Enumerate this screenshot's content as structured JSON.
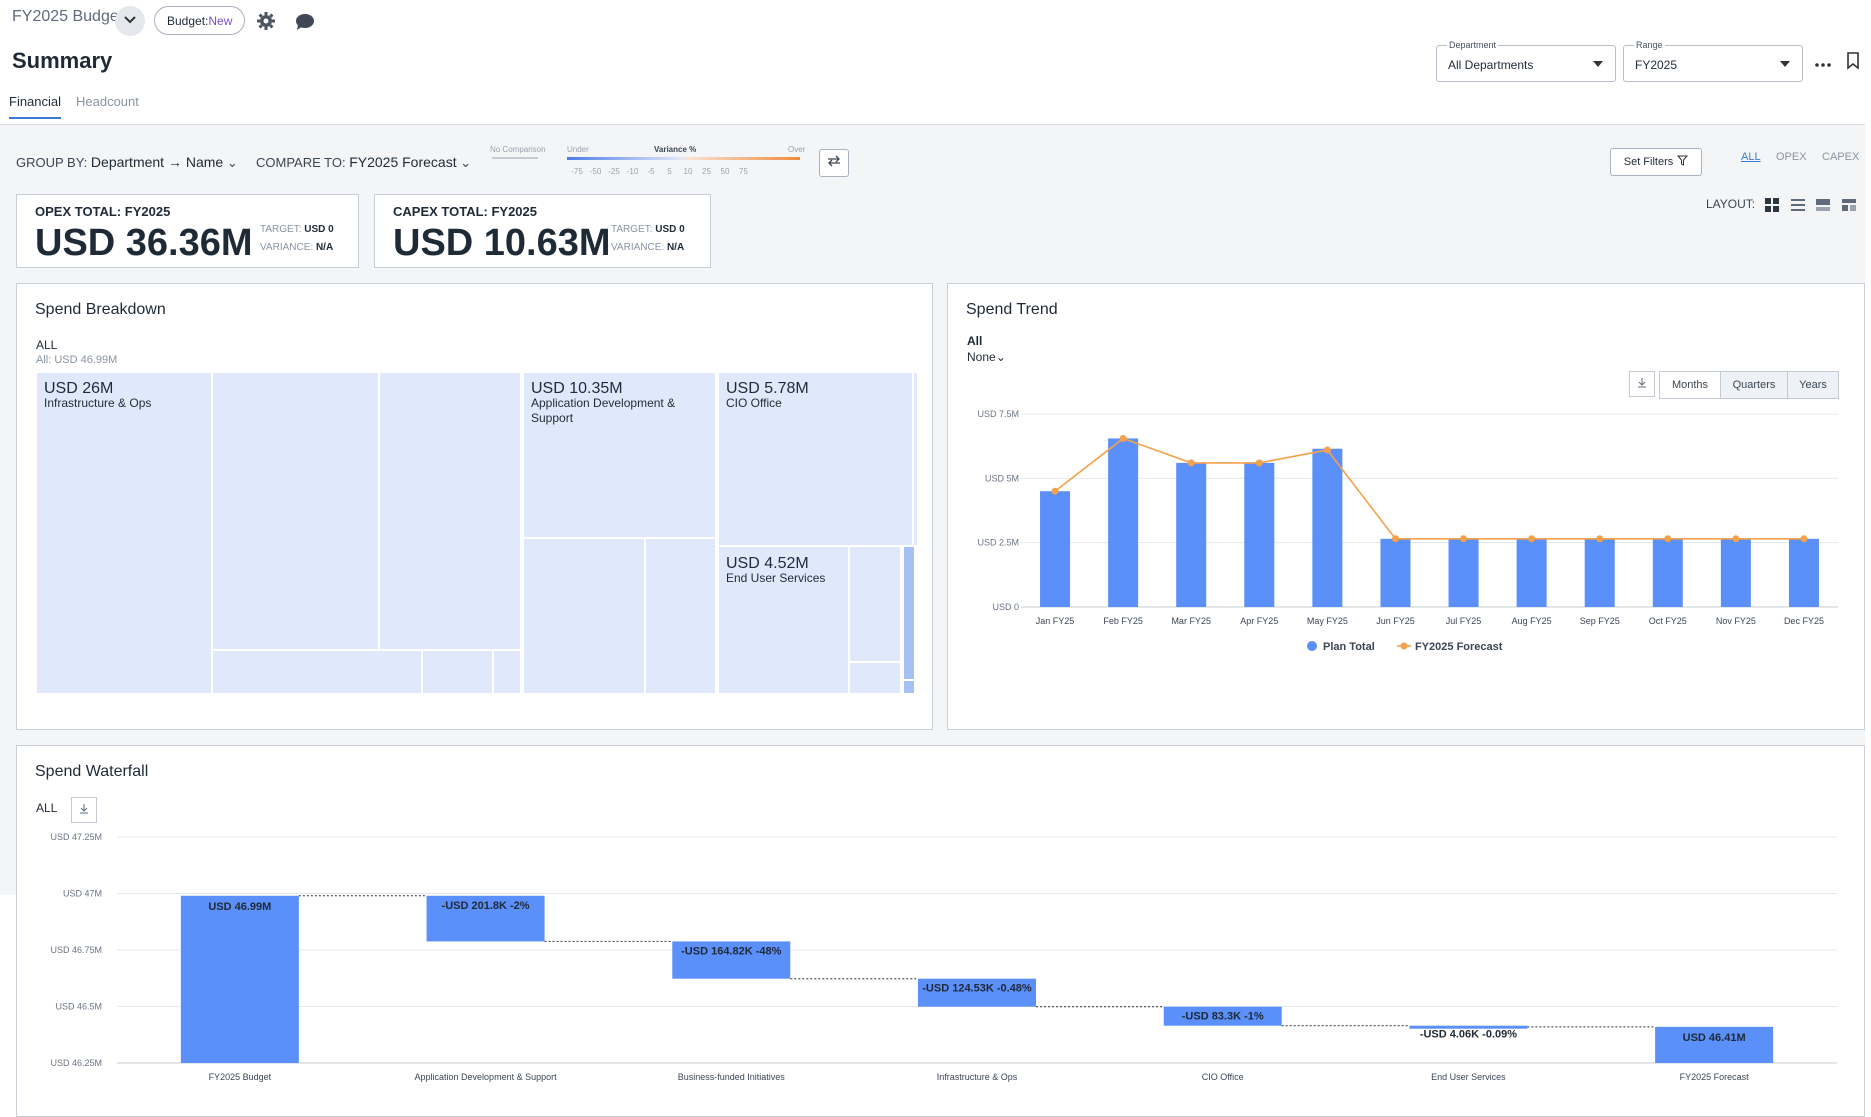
{
  "header": {
    "budget_name": "FY2025 Budget",
    "budget_badge_prefix": "Budget:",
    "budget_badge_status": "New",
    "page_title": "Summary",
    "tabs": [
      {
        "label": "Financial"
      },
      {
        "label": "Headcount"
      }
    ],
    "department": {
      "label": "Department",
      "value": "All Departments"
    },
    "range": {
      "label": "Range",
      "value": "FY2025"
    }
  },
  "filters": {
    "group_by_label": "GROUP BY:",
    "group_by_value": "Department → Name",
    "compare_label": "COMPARE TO:",
    "compare_value": "FY2025 Forecast",
    "variance_legend": {
      "no_comparison": "No Comparison",
      "under": "Under",
      "title": "Variance %",
      "over": "Over",
      "ticks": [
        "-75",
        "-50",
        "-25",
        "-10",
        "-5",
        "5",
        "10",
        "25",
        "50",
        "75"
      ]
    },
    "set_filters": "Set Filters",
    "scope": [
      "ALL",
      "OPEX",
      "CAPEX"
    ],
    "layout_label": "LAYOUT:"
  },
  "kpis": [
    {
      "title": "OPEX TOTAL: FY2025",
      "value": "USD 36.36M",
      "target_label": "TARGET:",
      "target": "USD 0",
      "variance_label": "VARIANCE:",
      "variance": "N/A"
    },
    {
      "title": "CAPEX TOTAL: FY2025",
      "value": "USD 10.63M",
      "target_label": "TARGET:",
      "target": "USD 0",
      "variance_label": "VARIANCE:",
      "variance": "N/A"
    }
  ],
  "spend_breakdown": {
    "title": "Spend Breakdown",
    "crumb": "ALL",
    "total": "All: USD 46.99M",
    "tiles": [
      {
        "value": "USD 26M",
        "name": "Infrastructure & Ops"
      },
      {
        "value": "USD 10.35M",
        "name": "Application Development & Support"
      },
      {
        "value": "USD 5.78M",
        "name": "CIO Office"
      },
      {
        "value": "USD 4.52M",
        "name": "End User Services"
      }
    ]
  },
  "spend_trend": {
    "title": "Spend Trend",
    "filter_value": "All",
    "compare_value": "None",
    "periods": [
      "Months",
      "Quarters",
      "Years"
    ],
    "colors": {
      "plan": "#5b8ff9",
      "forecast": "#f5a04a"
    }
  },
  "spend_waterfall": {
    "title": "Spend Waterfall",
    "crumb": "ALL"
  },
  "chart_data": [
    {
      "type": "bar",
      "title": "Spend Trend",
      "categories": [
        "Jan FY25",
        "Feb FY25",
        "Mar FY25",
        "Apr FY25",
        "May FY25",
        "Jun FY25",
        "Jul FY25",
        "Aug FY25",
        "Sep FY25",
        "Oct FY25",
        "Nov FY25",
        "Dec FY25"
      ],
      "series": [
        {
          "name": "Plan Total",
          "type": "bar",
          "values": [
            4.5,
            6.55,
            5.6,
            5.6,
            6.15,
            2.65,
            2.65,
            2.65,
            2.65,
            2.65,
            2.65,
            2.65
          ]
        },
        {
          "name": "FY2025 Forecast",
          "type": "line",
          "values": [
            4.5,
            6.55,
            5.6,
            5.6,
            6.1,
            2.65,
            2.65,
            2.65,
            2.65,
            2.65,
            2.65,
            2.65
          ]
        }
      ],
      "yticks": [
        "USD 0",
        "USD 2.5M",
        "USD 5M",
        "USD 7.5M"
      ],
      "ylim": [
        0,
        7.5
      ],
      "yunit": "USD M",
      "legend_position": "bottom"
    },
    {
      "type": "waterfall",
      "title": "Spend Waterfall",
      "categories": [
        "FY2025 Budget",
        "Application Development & Support",
        "Business-funded Initiatives",
        "Infrastructure & Ops",
        "CIO Office",
        "End User Services",
        "FY2025 Forecast"
      ],
      "steps": [
        {
          "kind": "total",
          "start": 46.99,
          "end": 46.99,
          "label": "USD 46.99M"
        },
        {
          "kind": "delta",
          "start": 46.99,
          "end": 46.788,
          "label": "-USD 201.8K -2%"
        },
        {
          "kind": "delta",
          "start": 46.788,
          "end": 46.623,
          "label": "-USD 164.82K -48%"
        },
        {
          "kind": "delta",
          "start": 46.623,
          "end": 46.499,
          "label": "-USD 124.53K -0.48%"
        },
        {
          "kind": "delta",
          "start": 46.499,
          "end": 46.415,
          "label": "-USD 83.3K -1%"
        },
        {
          "kind": "delta",
          "start": 46.415,
          "end": 46.411,
          "label": "-USD 4.06K -0.09%"
        },
        {
          "kind": "total",
          "start": 46.41,
          "end": 46.41,
          "label": "USD 46.41M"
        }
      ],
      "yticks": [
        "USD 46.25M",
        "USD 46.5M",
        "USD 46.75M",
        "USD 47M",
        "USD 47.25M"
      ],
      "ylim": [
        46.25,
        47.25
      ],
      "yunit": "USD M"
    }
  ]
}
